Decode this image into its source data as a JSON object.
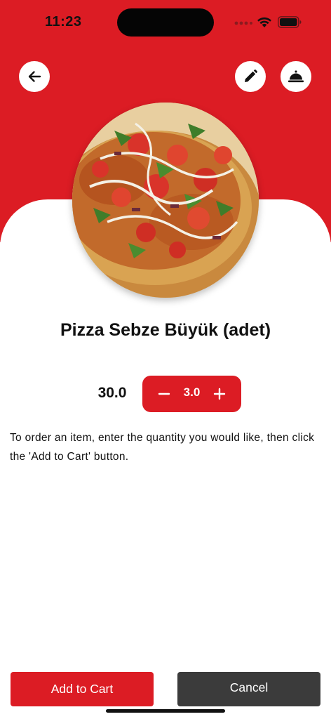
{
  "status_bar": {
    "time": "11:23"
  },
  "header": {
    "back_icon": "arrow-left-icon",
    "edit_icon": "pencil-icon",
    "service_icon": "service-bell-icon"
  },
  "colors": {
    "brand_red": "#dc1c24",
    "dark_button": "#3b3b3b",
    "text": "#111111"
  },
  "product": {
    "title": "Pizza Sebze Büyük (adet)",
    "price": "30.0",
    "quantity": "3.0",
    "image_icon": "pizza-image"
  },
  "instructions": "To order an item, enter the quantity you would like, then click the 'Add to Cart' button.",
  "actions": {
    "add_to_cart": "Add to Cart",
    "cancel": "Cancel"
  }
}
